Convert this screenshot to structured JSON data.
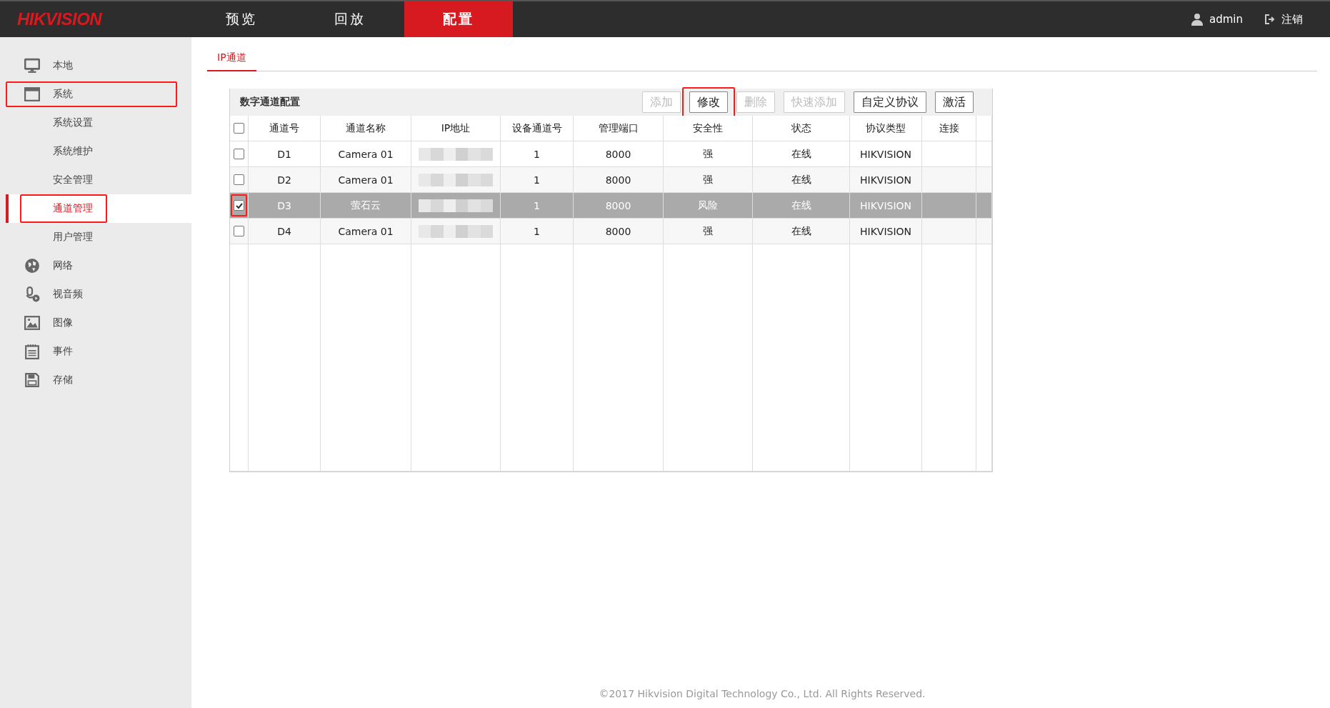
{
  "header": {
    "logo": "HIKVISION",
    "nav": [
      {
        "label": "预览",
        "selected": false
      },
      {
        "label": "回放",
        "selected": false
      },
      {
        "label": "配置",
        "selected": true
      }
    ],
    "user": "admin",
    "logout": "注销"
  },
  "sidebar": {
    "items": [
      {
        "label": "本地",
        "selected": false,
        "highlighted": false
      },
      {
        "label": "系统",
        "selected": false,
        "highlighted": true,
        "children": [
          {
            "label": "系统设置",
            "selected": false,
            "highlighted": false
          },
          {
            "label": "系统维护",
            "selected": false,
            "highlighted": false
          },
          {
            "label": "安全管理",
            "selected": false,
            "highlighted": false
          },
          {
            "label": "通道管理",
            "selected": true,
            "highlighted": true
          },
          {
            "label": "用户管理",
            "selected": false,
            "highlighted": false
          }
        ]
      },
      {
        "label": "网络",
        "selected": false,
        "highlighted": false
      },
      {
        "label": "视音频",
        "selected": false,
        "highlighted": false
      },
      {
        "label": "图像",
        "selected": false,
        "highlighted": false
      },
      {
        "label": "事件",
        "selected": false,
        "highlighted": false
      },
      {
        "label": "存储",
        "selected": false,
        "highlighted": false
      }
    ]
  },
  "tabs": [
    {
      "label": "IP通道",
      "selected": true
    }
  ],
  "panel": {
    "title": "数字通道配置",
    "buttons": [
      {
        "label": "添加",
        "disabled": true,
        "highlighted": false
      },
      {
        "label": "修改",
        "disabled": false,
        "highlighted": true
      },
      {
        "label": "删除",
        "disabled": true,
        "highlighted": false
      },
      {
        "label": "快速添加",
        "disabled": true,
        "highlighted": false
      },
      {
        "label": "自定义协议",
        "disabled": false,
        "highlighted": false
      },
      {
        "label": "激活",
        "disabled": false,
        "highlighted": false
      }
    ],
    "table": {
      "header_checked": false,
      "columns": [
        "通道号",
        "通道名称",
        "IP地址",
        "设备通道号",
        "管理端口",
        "安全性",
        "状态",
        "协议类型",
        "连接"
      ],
      "rows": [
        {
          "checked": false,
          "selected": false,
          "highlighted": false,
          "cells": [
            "D1",
            "Camera 01",
            "",
            "1",
            "8000",
            "强",
            "在线",
            "HIKVISION",
            ""
          ]
        },
        {
          "checked": false,
          "selected": false,
          "highlighted": false,
          "cells": [
            "D2",
            "Camera 01",
            "",
            "1",
            "8000",
            "强",
            "在线",
            "HIKVISION",
            ""
          ]
        },
        {
          "checked": true,
          "selected": true,
          "highlighted": true,
          "cells": [
            "D3",
            "萤石云",
            "",
            "1",
            "8000",
            "风险",
            "在线",
            "HIKVISION",
            ""
          ]
        },
        {
          "checked": false,
          "selected": false,
          "highlighted": false,
          "cells": [
            "D4",
            "Camera 01",
            "",
            "1",
            "8000",
            "强",
            "在线",
            "HIKVISION",
            ""
          ]
        }
      ]
    }
  },
  "footer": "©2017 Hikvision Digital Technology Co., Ltd. All Rights Reserved."
}
